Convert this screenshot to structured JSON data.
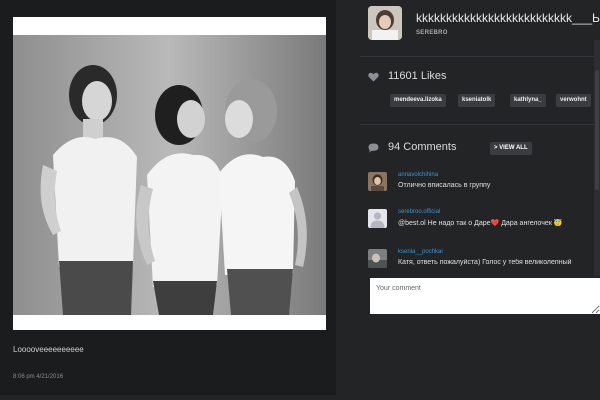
{
  "post": {
    "caption": "Looooveeeeeeeeee",
    "timestamp": "8:06 pm 4/21/2016"
  },
  "header": {
    "title": "kkkkkkkkkkkkkkkkkkkkkkkkkk___Ы",
    "account": "SEREBRO"
  },
  "likes": {
    "count_label": "11601 Likes",
    "likers": [
      "mendeeva.lizoka",
      "kseniatolk",
      "kathlyna_",
      "verwohnt"
    ]
  },
  "comments": {
    "count_label": "94 Comments",
    "view_all_label": "> VIEW ALL",
    "items": [
      {
        "user": "annavolchihina",
        "text": "Отлично вписалась в группу"
      },
      {
        "user": "serebroo.official",
        "text": "@best.ol Не надо так о Даре❤️ Дара ангелочек 😇"
      },
      {
        "user": "ksenia__pochkai",
        "text": "Катя, ответь пожалуйста) Голос у тебя великолепный"
      }
    ],
    "input_placeholder": "Your comment"
  },
  "colors": {
    "background": "#222426",
    "card": "#1b1c1e",
    "link": "#3b96d1",
    "tag_bg": "#3a3c3f"
  },
  "icons": {
    "likes": "heart-icon",
    "comments": "speech-bubble-icon"
  }
}
